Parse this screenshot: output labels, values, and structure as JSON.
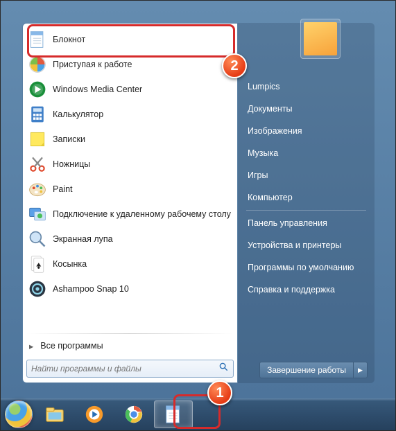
{
  "programs": [
    {
      "key": "notepad",
      "label": "Блокнот"
    },
    {
      "key": "getting-started",
      "label": "Приступая к работе"
    },
    {
      "key": "wmc",
      "label": "Windows Media Center"
    },
    {
      "key": "calc",
      "label": "Калькулятор"
    },
    {
      "key": "notes",
      "label": "Записки"
    },
    {
      "key": "snip",
      "label": "Ножницы"
    },
    {
      "key": "paint",
      "label": "Paint"
    },
    {
      "key": "rdp",
      "label": "Подключение к удаленному рабочему столу"
    },
    {
      "key": "magnifier",
      "label": "Экранная лупа"
    },
    {
      "key": "solitaire",
      "label": "Косынка"
    },
    {
      "key": "ashampoo",
      "label": "Ashampoo Snap 10"
    }
  ],
  "allprograms": "Все программы",
  "search": {
    "placeholder": "Найти программы и файлы"
  },
  "right": {
    "user": "Lumpics",
    "items": [
      "Документы",
      "Изображения",
      "Музыка",
      "Игры",
      "Компьютер"
    ],
    "items2": [
      "Панель управления",
      "Устройства и принтеры",
      "Программы по умолчанию",
      "Справка и поддержка"
    ]
  },
  "shutdown": {
    "label": "Завершение работы"
  },
  "callouts": {
    "one": "1",
    "two": "2"
  }
}
